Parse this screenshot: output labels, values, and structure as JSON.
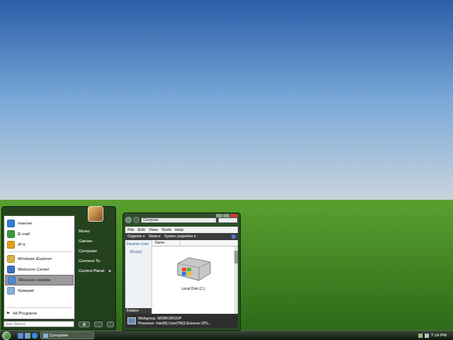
{
  "start_menu": {
    "pinned": [
      {
        "label": "Internet",
        "selected": false
      },
      {
        "label": "E-mail",
        "selected": false
      }
    ],
    "recent": [
      {
        "label": "IP-it",
        "selected": false
      },
      {
        "label": "Windows Explorer",
        "selected": false
      },
      {
        "label": "Welcome Center",
        "selected": false
      },
      {
        "label": "Windows Update",
        "selected": true
      },
      {
        "label": "Notepad",
        "selected": false
      }
    ],
    "all_programs": "All Programs",
    "all_programs_arrow": "▶",
    "search_placeholder": "Start Search",
    "places": [
      {
        "label": "Music",
        "submenu": false
      },
      {
        "label": "Games",
        "submenu": false
      },
      {
        "label": "Computer",
        "submenu": false
      },
      {
        "label": "Connect To",
        "submenu": false
      },
      {
        "label": "Control Panel",
        "submenu": true
      }
    ],
    "submenu_arrow": "▸"
  },
  "explorer": {
    "address": "Computer",
    "menu": [
      "File",
      "Edit",
      "View",
      "Tools",
      "Help"
    ],
    "toolbar": [
      {
        "label": "Organize",
        "dropdown": true
      },
      {
        "label": "Views",
        "dropdown": true
      },
      {
        "label": "System properties",
        "dropdown": true
      }
    ],
    "dropdown_arrow": "▾",
    "nav_pane": {
      "title": "Favorite Links",
      "items": [
        "(Empty)"
      ],
      "folders": "Folders"
    },
    "columns": [
      "Name"
    ],
    "items": [
      {
        "label": "Local Disk (C:)",
        "selected": false
      }
    ],
    "details": [
      "Workgroup: WORKGROUP",
      "Processor: Intel(R) Core(TM)2 Extreme CPU..."
    ]
  },
  "taskbar": {
    "tasks": [
      {
        "label": "Computer",
        "selected": true
      }
    ],
    "clock": "7:14 PM"
  }
}
